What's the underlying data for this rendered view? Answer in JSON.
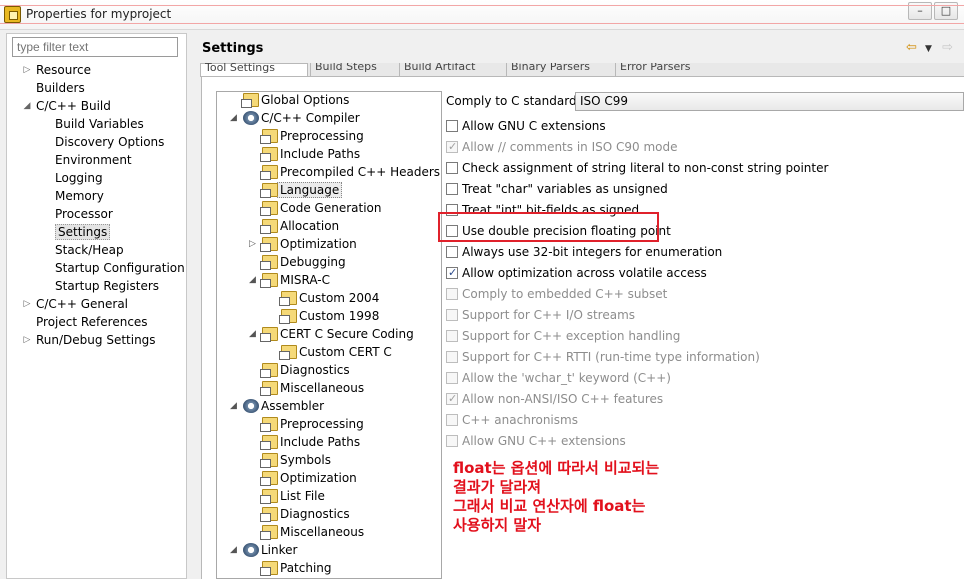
{
  "window": {
    "title": "Properties for myproject",
    "minimize_label": "–",
    "maximize_label": "□"
  },
  "filter": {
    "placeholder": "type filter text"
  },
  "nav": [
    {
      "label": "Resource",
      "expand": "▷"
    },
    {
      "label": "Builders"
    },
    {
      "label": "C/C++ Build",
      "expand": "◢"
    },
    {
      "label": "Build Variables"
    },
    {
      "label": "Discovery Options"
    },
    {
      "label": "Environment"
    },
    {
      "label": "Logging"
    },
    {
      "label": "Memory"
    },
    {
      "label": "Processor"
    },
    {
      "label": "Settings"
    },
    {
      "label": "Stack/Heap"
    },
    {
      "label": "Startup Configuration"
    },
    {
      "label": "Startup Registers"
    },
    {
      "label": "C/C++ General",
      "expand": "▷"
    },
    {
      "label": "Project References"
    },
    {
      "label": "Run/Debug Settings",
      "expand": "▷"
    }
  ],
  "header": {
    "title": "Settings",
    "back_icon": "⇦",
    "menu_icon": "▼",
    "forward_icon": "⇨"
  },
  "tabs": [
    "Tool Settings",
    "Build Steps",
    "Build Artifact",
    "Binary Parsers",
    "Error Parsers"
  ],
  "tree": [
    {
      "label": "Global Options"
    },
    {
      "label": "C/C++ Compiler",
      "expand": "◢"
    },
    {
      "label": "Preprocessing"
    },
    {
      "label": "Include Paths"
    },
    {
      "label": "Precompiled C++ Headers"
    },
    {
      "label": "Language"
    },
    {
      "label": "Code Generation"
    },
    {
      "label": "Allocation"
    },
    {
      "label": "Optimization",
      "expand": "▷"
    },
    {
      "label": "Debugging"
    },
    {
      "label": "MISRA-C",
      "expand": "◢"
    },
    {
      "label": "Custom 2004"
    },
    {
      "label": "Custom 1998"
    },
    {
      "label": "CERT C Secure Coding",
      "expand": "◢"
    },
    {
      "label": "Custom CERT C"
    },
    {
      "label": "Diagnostics"
    },
    {
      "label": "Miscellaneous"
    },
    {
      "label": "Assembler",
      "expand": "◢"
    },
    {
      "label": "Preprocessing"
    },
    {
      "label": "Include Paths"
    },
    {
      "label": "Symbols"
    },
    {
      "label": "Optimization"
    },
    {
      "label": "List File"
    },
    {
      "label": "Diagnostics"
    },
    {
      "label": "Miscellaneous"
    },
    {
      "label": "Linker",
      "expand": "◢"
    },
    {
      "label": "Patching"
    }
  ],
  "options": {
    "comply_label": "Comply to C standard:",
    "comply_value": "ISO C99",
    "checkboxes": [
      {
        "label": "Allow GNU C extensions",
        "checked": false,
        "enabled": true
      },
      {
        "label": "Allow // comments in ISO C90 mode",
        "checked": true,
        "enabled": false
      },
      {
        "label": "Check assignment of string literal to non-const string pointer",
        "checked": false,
        "enabled": true
      },
      {
        "label": "Treat \"char\" variables as unsigned",
        "checked": false,
        "enabled": true
      },
      {
        "label": "Treat \"int\" bit-fields as signed",
        "checked": false,
        "enabled": true
      },
      {
        "label": "Use double precision floating point",
        "checked": false,
        "enabled": true
      },
      {
        "label": "Always use 32-bit integers for enumeration",
        "checked": false,
        "enabled": true
      },
      {
        "label": "Allow optimization across volatile access",
        "checked": true,
        "enabled": true
      },
      {
        "label": "Comply to embedded C++ subset",
        "checked": false,
        "enabled": false
      },
      {
        "label": "Support for C++ I/O streams",
        "checked": false,
        "enabled": false
      },
      {
        "label": "Support for C++ exception handling",
        "checked": false,
        "enabled": false
      },
      {
        "label": "Support for C++ RTTI (run-time type information)",
        "checked": false,
        "enabled": false
      },
      {
        "label": "Allow the 'wchar_t' keyword (C++)",
        "checked": false,
        "enabled": false
      },
      {
        "label": "Allow non-ANSI/ISO C++ features",
        "checked": true,
        "enabled": false
      },
      {
        "label": "C++ anachronisms",
        "checked": false,
        "enabled": false
      },
      {
        "label": "Allow GNU C++ extensions",
        "checked": false,
        "enabled": false
      }
    ]
  },
  "annotation": {
    "lines": [
      "float는 옵션에 따라서 비교되는",
      "결과가 달라져",
      "그래서 비교 연산자에 float는",
      "사용하지 말자"
    ],
    "color": "#e2101c"
  },
  "colors": {
    "highlight_box": "#e0212b"
  }
}
